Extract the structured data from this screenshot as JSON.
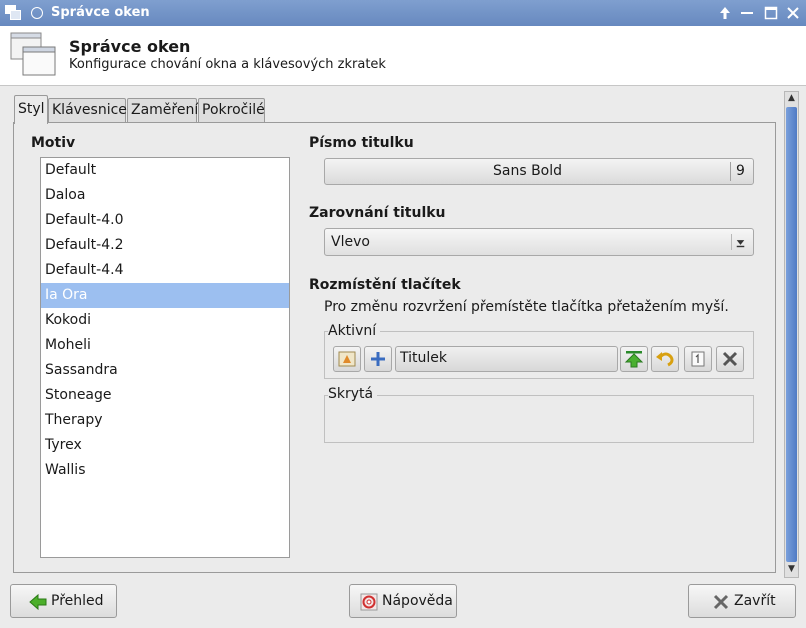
{
  "window": {
    "title": "Správce oken"
  },
  "header": {
    "title": "Správce oken",
    "subtitle": "Konfigurace chování okna a klávesových zkratek"
  },
  "tabs": [
    {
      "label": "Styl",
      "active": true
    },
    {
      "label": "Klávesnice",
      "active": false
    },
    {
      "label": "Zaměření",
      "active": false
    },
    {
      "label": "Pokročilé",
      "active": false
    }
  ],
  "style": {
    "theme_label": "Motiv",
    "themes": [
      "Default",
      "Daloa",
      "Default-4.0",
      "Default-4.2",
      "Default-4.4",
      "Ia Ora",
      "Kokodi",
      "Moheli",
      "Sassandra",
      "Stoneage",
      "Therapy",
      "Tyrex",
      "Wallis"
    ],
    "selected_theme": "Ia Ora",
    "font_label": "Písmo titulku",
    "font_name": "Sans Bold",
    "font_size": "9",
    "align_label": "Zarovnání titulku",
    "align_value": "Vlevo",
    "buttons_label": "Rozmístění tlačítek",
    "buttons_hint": "Pro změnu rozvržení přemístěte tlačítka přetažením myší.",
    "active_group": "Aktivní",
    "title_item": "Titulek",
    "hidden_group": "Skrytá"
  },
  "footer": {
    "overview": "Přehled",
    "help": "Nápověda",
    "close": "Zavřít"
  },
  "colors": {
    "titlebar": "#7594c7",
    "selection": "#9cbff0",
    "scroll_thumb": "#5b85cd"
  }
}
